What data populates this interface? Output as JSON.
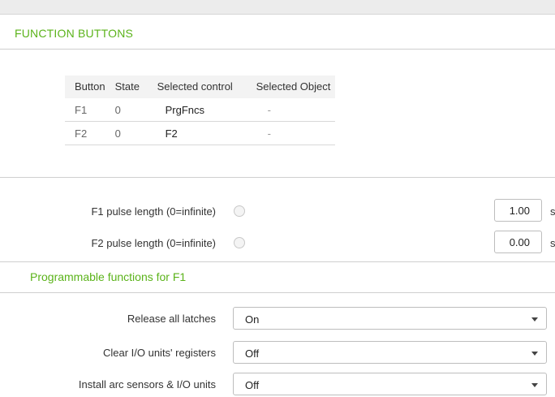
{
  "function_buttons": {
    "title": "FUNCTION BUTTONS",
    "columns": [
      "Button",
      "State",
      "Selected control",
      "Selected Object"
    ],
    "rows": [
      {
        "button": "F1",
        "state": "0",
        "control": "PrgFncs",
        "object": "-"
      },
      {
        "button": "F2",
        "state": "0",
        "control": "F2",
        "object": "-"
      }
    ]
  },
  "pulse": {
    "f1": {
      "label": "F1 pulse length (0=infinite)",
      "value": "1.00",
      "unit": "s"
    },
    "f2": {
      "label": "F2 pulse length (0=infinite)",
      "value": "0.00",
      "unit": "s"
    }
  },
  "programmable": {
    "title": "Programmable functions for F1",
    "rows": [
      {
        "label": "Release all latches",
        "value": "On"
      },
      {
        "label": "Clear I/O units' registers",
        "value": "Off"
      },
      {
        "label": "Install arc sensors & I/O units",
        "value": "Off"
      }
    ]
  }
}
